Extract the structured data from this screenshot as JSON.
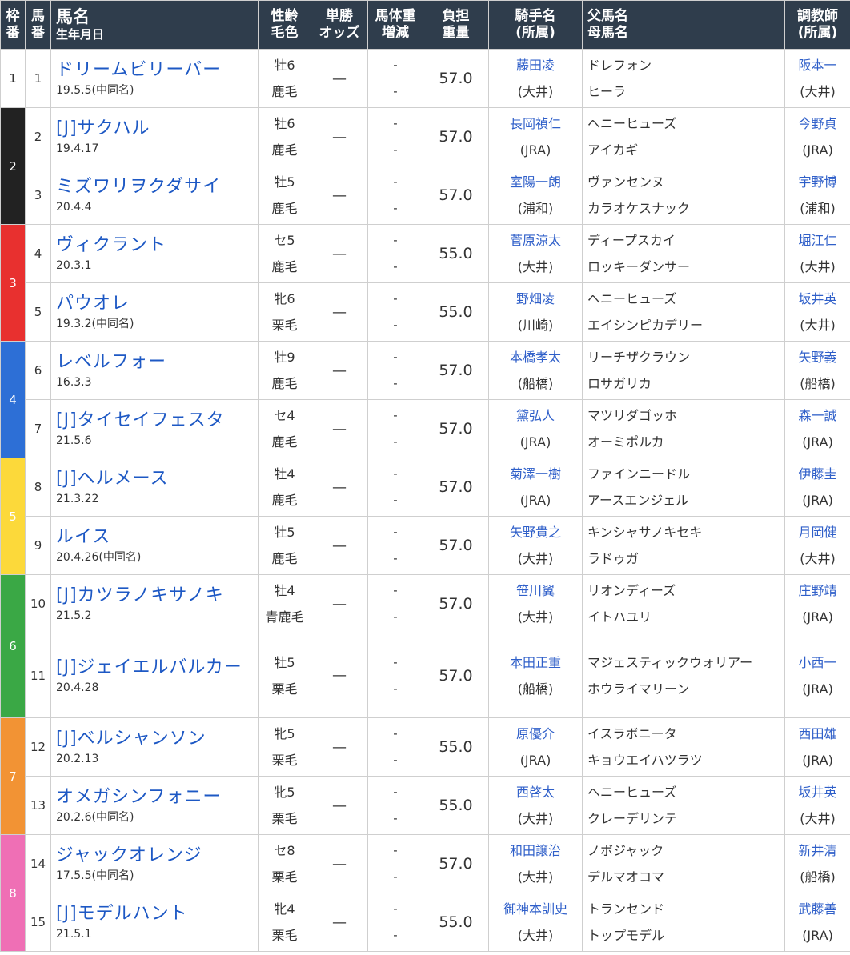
{
  "header": {
    "waku": [
      "枠",
      "番"
    ],
    "uma": [
      "馬",
      "番"
    ],
    "name": "馬名",
    "birth": "生年月日",
    "sex_age": [
      "性齢",
      "毛色"
    ],
    "odds": [
      "単勝",
      "オッズ"
    ],
    "weight_change": [
      "馬体重",
      "増減"
    ],
    "burden": [
      "負担",
      "重量"
    ],
    "jockey": [
      "騎手名",
      "(所属)"
    ],
    "parents": [
      "父馬名",
      "母馬名"
    ],
    "trainer": [
      "調教師",
      "(所属)"
    ]
  },
  "colors": {
    "header_bg": "#2f3d4c",
    "link_blue": "#1d58c4",
    "waku": {
      "1": "#ffffff",
      "2": "#222222",
      "3": "#e8302f",
      "4": "#2d6fd6",
      "5": "#fcd93a",
      "6": "#3aa845",
      "7": "#f29334",
      "8": "#ef6fb5"
    }
  },
  "wakus": [
    {
      "label": "1",
      "rows": 1,
      "color": "#ffffff"
    },
    {
      "label": "2",
      "rows": 2,
      "color": "#222222"
    },
    {
      "label": "3",
      "rows": 2,
      "color": "#e8302f"
    },
    {
      "label": "4",
      "rows": 2,
      "color": "#2d6fd6"
    },
    {
      "label": "5",
      "rows": 2,
      "color": "#fcd93a"
    },
    {
      "label": "6",
      "rows": 2,
      "color": "#3aa845"
    },
    {
      "label": "7",
      "rows": 2,
      "color": "#f29334"
    },
    {
      "label": "8",
      "rows": 2,
      "color": "#ef6fb5"
    }
  ],
  "horses": [
    {
      "num": "1",
      "name": "ドリームビリーバー",
      "birth": "19.5.5(中同名)",
      "sex": "牡6",
      "coat": "鹿毛",
      "odds": "—",
      "bw": "-",
      "bwc": "-",
      "burden": "57.0",
      "jockey": "藤田凌",
      "jaff": "(大井)",
      "sire": "ドレフォン",
      "dam": "ヒーラ",
      "trainer": "阪本一",
      "taff": "(大井)"
    },
    {
      "num": "2",
      "name": "[J]サクハル",
      "birth": "19.4.17",
      "sex": "牡6",
      "coat": "鹿毛",
      "odds": "—",
      "bw": "-",
      "bwc": "-",
      "burden": "57.0",
      "jockey": "長岡禎仁",
      "jaff": "(JRA)",
      "sire": "ヘニーヒューズ",
      "dam": "アイカギ",
      "trainer": "今野貞",
      "taff": "(JRA)"
    },
    {
      "num": "3",
      "name": "ミズワリヲクダサイ",
      "birth": "20.4.4",
      "sex": "牡5",
      "coat": "鹿毛",
      "odds": "—",
      "bw": "-",
      "bwc": "-",
      "burden": "57.0",
      "jockey": "室陽一朗",
      "jaff": "(浦和)",
      "sire": "ヴァンセンヌ",
      "dam": "カラオケスナック",
      "trainer": "宇野博",
      "taff": "(浦和)"
    },
    {
      "num": "4",
      "name": "ヴィクラント",
      "birth": "20.3.1",
      "sex": "セ5",
      "coat": "鹿毛",
      "odds": "—",
      "bw": "-",
      "bwc": "-",
      "burden": "55.0",
      "jockey": "菅原涼太",
      "jaff": "(大井)",
      "sire": "ディープスカイ",
      "dam": "ロッキーダンサー",
      "trainer": "堀江仁",
      "taff": "(大井)"
    },
    {
      "num": "5",
      "name": "パウオレ",
      "birth": "19.3.2(中同名)",
      "sex": "牝6",
      "coat": "栗毛",
      "odds": "—",
      "bw": "-",
      "bwc": "-",
      "burden": "55.0",
      "jockey": "野畑凌",
      "jaff": "(川崎)",
      "sire": "ヘニーヒューズ",
      "dam": "エイシンピカデリー",
      "trainer": "坂井英",
      "taff": "(大井)"
    },
    {
      "num": "6",
      "name": "レベルフォー",
      "birth": "16.3.3",
      "sex": "牡9",
      "coat": "鹿毛",
      "odds": "—",
      "bw": "-",
      "bwc": "-",
      "burden": "57.0",
      "jockey": "本橋孝太",
      "jaff": "(船橋)",
      "sire": "リーチザクラウン",
      "dam": "ロサガリカ",
      "trainer": "矢野義",
      "taff": "(船橋)"
    },
    {
      "num": "7",
      "name": "[J]タイセイフェスタ",
      "birth": "21.5.6",
      "sex": "セ4",
      "coat": "鹿毛",
      "odds": "—",
      "bw": "-",
      "bwc": "-",
      "burden": "57.0",
      "jockey": "黛弘人",
      "jaff": "(JRA)",
      "sire": "マツリダゴッホ",
      "dam": "オーミポルカ",
      "trainer": "森一誠",
      "taff": "(JRA)"
    },
    {
      "num": "8",
      "name": "[J]ヘルメース",
      "birth": "21.3.22",
      "sex": "牡4",
      "coat": "鹿毛",
      "odds": "—",
      "bw": "-",
      "bwc": "-",
      "burden": "57.0",
      "jockey": "菊澤一樹",
      "jaff": "(JRA)",
      "sire": "ファインニードル",
      "dam": "アースエンジェル",
      "trainer": "伊藤圭",
      "taff": "(JRA)"
    },
    {
      "num": "9",
      "name": "ルイス",
      "birth": "20.4.26(中同名)",
      "sex": "牡5",
      "coat": "鹿毛",
      "odds": "—",
      "bw": "-",
      "bwc": "-",
      "burden": "57.0",
      "jockey": "矢野貴之",
      "jaff": "(大井)",
      "sire": "キンシャサノキセキ",
      "dam": "ラドゥガ",
      "trainer": "月岡健",
      "taff": "(大井)"
    },
    {
      "num": "10",
      "name": "[J]カツラノキサノキ",
      "birth": "21.5.2",
      "sex": "牡4",
      "coat": "青鹿毛",
      "odds": "—",
      "bw": "-",
      "bwc": "-",
      "burden": "57.0",
      "jockey": "笹川翼",
      "jaff": "(大井)",
      "sire": "リオンディーズ",
      "dam": "イトハユリ",
      "trainer": "庄野靖",
      "taff": "(JRA)"
    },
    {
      "num": "11",
      "name": "[J]ジェイエルバルカー",
      "birth": "20.4.28",
      "sex": "牡5",
      "coat": "栗毛",
      "odds": "—",
      "bw": "-",
      "bwc": "-",
      "burden": "57.0",
      "jockey": "本田正重",
      "jaff": "(船橋)",
      "sire": "マジェスティックウォリアー",
      "dam": "ホウライマリーン",
      "trainer": "小西一",
      "taff": "(JRA)"
    },
    {
      "num": "12",
      "name": "[J]ベルシャンソン",
      "birth": "20.2.13",
      "sex": "牝5",
      "coat": "栗毛",
      "odds": "—",
      "bw": "-",
      "bwc": "-",
      "burden": "55.0",
      "jockey": "原優介",
      "jaff": "(JRA)",
      "sire": "イスラボニータ",
      "dam": "キョウエイハツラツ",
      "trainer": "西田雄",
      "taff": "(JRA)"
    },
    {
      "num": "13",
      "name": "オメガシンフォニー",
      "birth": "20.2.6(中同名)",
      "sex": "牝5",
      "coat": "栗毛",
      "odds": "—",
      "bw": "-",
      "bwc": "-",
      "burden": "55.0",
      "jockey": "西啓太",
      "jaff": "(大井)",
      "sire": "ヘニーヒューズ",
      "dam": "クレーデリンテ",
      "trainer": "坂井英",
      "taff": "(大井)"
    },
    {
      "num": "14",
      "name": "ジャックオレンジ",
      "birth": "17.5.5(中同名)",
      "sex": "セ8",
      "coat": "栗毛",
      "odds": "—",
      "bw": "-",
      "bwc": "-",
      "burden": "57.0",
      "jockey": "和田譲治",
      "jaff": "(大井)",
      "sire": "ノボジャック",
      "dam": "デルマオコマ",
      "trainer": "新井清",
      "taff": "(船橋)"
    },
    {
      "num": "15",
      "name": "[J]モデルハント",
      "birth": "21.5.1",
      "sex": "牝4",
      "coat": "栗毛",
      "odds": "—",
      "bw": "-",
      "bwc": "-",
      "burden": "55.0",
      "jockey": "御神本訓史",
      "jaff": "(大井)",
      "sire": "トランセンド",
      "dam": "トップモデル",
      "trainer": "武藤善",
      "taff": "(JRA)"
    }
  ]
}
